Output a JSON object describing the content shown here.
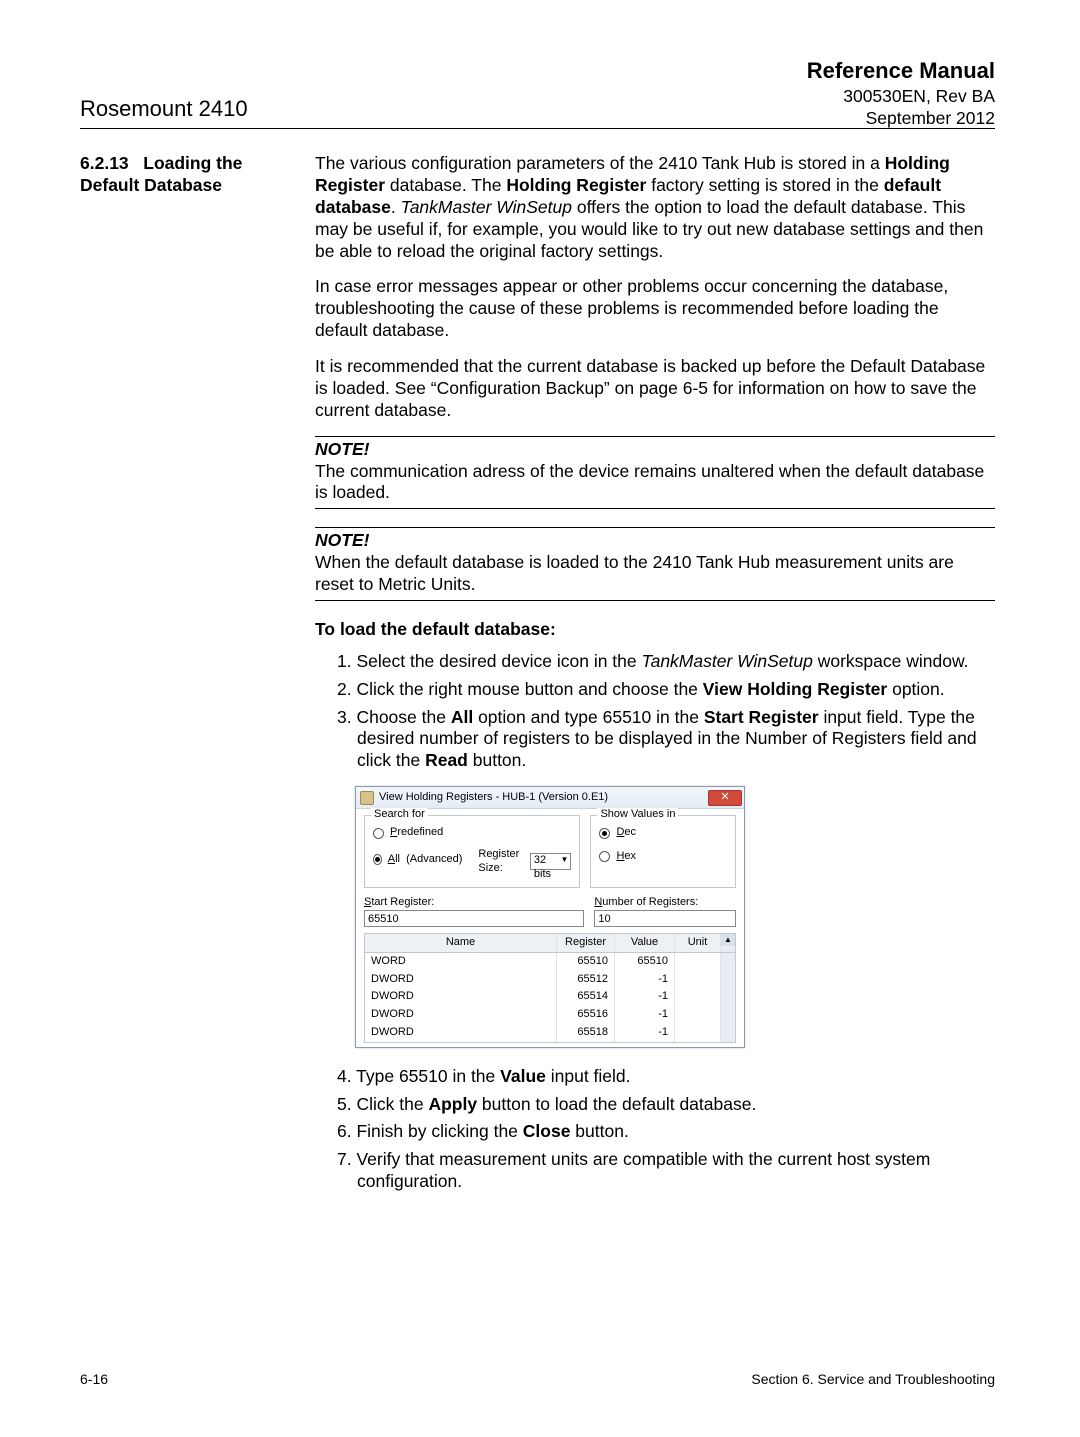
{
  "header": {
    "product": "Rosemount 2410",
    "ref_manual": "Reference Manual",
    "doc_rev": "300530EN, Rev BA",
    "date": "September 2012"
  },
  "section": {
    "num": "6.2.13",
    "title_line1": "Loading the",
    "title_line2": "Default Database"
  },
  "body": {
    "p1a": "The various configuration parameters of the 2410 Tank Hub is stored in a ",
    "p1b_bold": "Holding Register",
    "p1c": " database. The ",
    "p1d_bold": "Holding Register",
    "p1e": " factory setting is stored in the ",
    "p1f_bold": "default database",
    "p1g": ". ",
    "p1h_ital": "TankMaster WinSetup",
    "p1i": " offers the option to load the default database. This may be useful if, for example, you would like to try out new database settings and then be able to reload the original factory settings.",
    "p2": "In case error messages appear or other problems occur concerning the database, troubleshooting the cause of these problems is recommended before loading the default database.",
    "p3": "It is recommended that the current database is backed up before the Default Database is loaded. See “Configuration Backup” on page 6-5 for information on how to save the current database.",
    "note_label": "NOTE!",
    "note1": "The communication adress of the device remains unaltered when the default database is loaded.",
    "note2": "When the default database is loaded to the 2410 Tank Hub measurement units are reset to Metric Units.",
    "subhead": "To load the default database:",
    "step1a": "1.  Select the desired device icon in the ",
    "step1b_ital": "TankMaster WinSetup",
    "step1c": " workspace window.",
    "step2a": "2.  Click the right mouse button and choose the ",
    "step2b_bold": "View Holding Register",
    "step2c": " option.",
    "step3a": "3.  Choose the ",
    "step3b_bold": "All",
    "step3c": " option and type 65510 in the ",
    "step3d_bold": "Start Register",
    "step3e": " input field. Type the desired number of registers to be displayed in the Number of Registers field and click the ",
    "step3f_bold": "Read",
    "step3g": " button.",
    "step4a": "4.  Type 65510 in the ",
    "step4b_bold": "Value",
    "step4c": " input field.",
    "step5a": "5.  Click the ",
    "step5b_bold": "Apply",
    "step5c": " button to load the default database.",
    "step6a": "6.  Finish by clicking the ",
    "step6b_bold": "Close",
    "step6c": " button.",
    "step7": "7.  Verify that measurement units are compatible with the current host system configuration."
  },
  "dialog": {
    "title": "View Holding Registers - HUB-1 (Version 0.E1)",
    "search_for": "Search for",
    "predefined": "Predefined",
    "all_adv": "All  (Advanced)",
    "reg_size_label": "Register Size:",
    "reg_size_value": "32 bits",
    "show_values": "Show Values in",
    "dec": "Dec",
    "hex": "Hex",
    "start_reg_label": "Start Register:",
    "start_reg_value": "65510",
    "num_reg_label": "Number of Registers:",
    "num_reg_value": "10",
    "col_name": "Name",
    "col_reg": "Register",
    "col_val": "Value",
    "col_unit": "Unit",
    "rows": [
      {
        "name": "WORD",
        "reg": "65510",
        "val": "65510",
        "unit": ""
      },
      {
        "name": "DWORD",
        "reg": "65512",
        "val": "-1",
        "unit": ""
      },
      {
        "name": "DWORD",
        "reg": "65514",
        "val": "-1",
        "unit": ""
      },
      {
        "name": "DWORD",
        "reg": "65516",
        "val": "-1",
        "unit": ""
      },
      {
        "name": "DWORD",
        "reg": "65518",
        "val": "-1",
        "unit": ""
      }
    ]
  },
  "footer": {
    "page": "6-16",
    "section": "Section 6. Service and Troubleshooting"
  }
}
